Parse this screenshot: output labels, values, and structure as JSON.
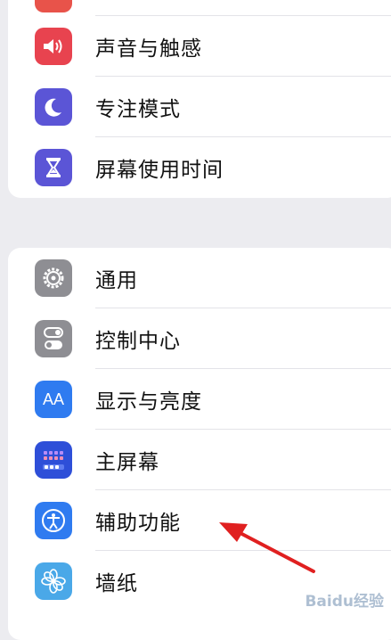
{
  "group1": [
    {
      "label": "",
      "icon": "partial-red-icon",
      "color": "#e8534a"
    },
    {
      "label": "声音与触感",
      "icon": "speaker-icon",
      "color": "#e8434f"
    },
    {
      "label": "专注模式",
      "icon": "moon-icon",
      "color": "#5b55d6"
    },
    {
      "label": "屏幕使用时间",
      "icon": "hourglass-icon",
      "color": "#5b55d6"
    }
  ],
  "group2": [
    {
      "label": "通用",
      "icon": "gear-icon",
      "color": "#8e8e93"
    },
    {
      "label": "控制中心",
      "icon": "toggles-icon",
      "color": "#8e8e93"
    },
    {
      "label": "显示与亮度",
      "icon": "aa-icon",
      "color": "#2f7bf0",
      "icon_text": "AA"
    },
    {
      "label": "主屏幕",
      "icon": "home-grid-icon",
      "color": "#2e4fd8"
    },
    {
      "label": "辅助功能",
      "icon": "accessibility-icon",
      "color": "#2f7bf0"
    },
    {
      "label": "墙纸",
      "icon": "flower-icon",
      "color": "#4aa8e8"
    }
  ],
  "watermark": "Baidu经验"
}
